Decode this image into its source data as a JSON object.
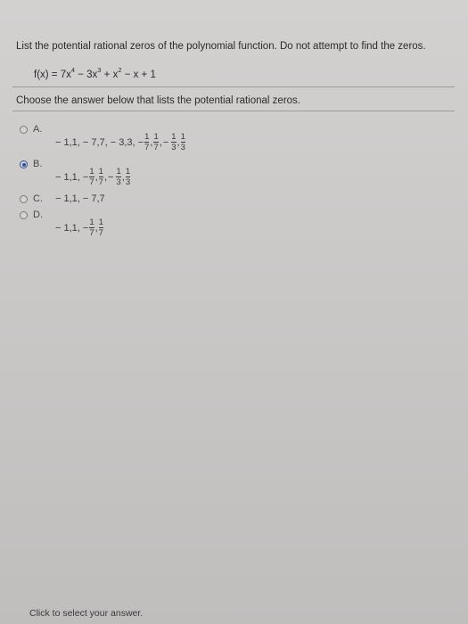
{
  "question": {
    "prompt": "List the potential rational zeros of the polynomial function. Do not attempt to find the zeros.",
    "formula": {
      "lhs": "f(x) = 7x",
      "exp1": "4",
      "t2": " − 3x",
      "exp2": "3",
      "t3": " + x",
      "exp3": "2",
      "t4": " − x + 1"
    },
    "instruction": "Choose the answer below that lists the potential rational zeros."
  },
  "options": [
    {
      "letter": "A.",
      "selected": false,
      "prefix": "− 1,1, − 7,7, − 3,3, −",
      "fracs": [
        {
          "num": "1",
          "den": "7"
        },
        {
          "num": "1",
          "den": "7"
        },
        {
          "num": "1",
          "den": "3"
        },
        {
          "num": "1",
          "den": "3"
        }
      ]
    },
    {
      "letter": "B.",
      "selected": true,
      "prefix": "− 1,1, −",
      "fracs": [
        {
          "num": "1",
          "den": "7"
        },
        {
          "num": "1",
          "den": "7"
        },
        {
          "num": "1",
          "den": "3"
        },
        {
          "num": "1",
          "den": "3"
        }
      ]
    },
    {
      "letter": "C.",
      "selected": false,
      "text": "− 1,1, − 7,7"
    },
    {
      "letter": "D.",
      "selected": false,
      "prefix": "− 1,1, −",
      "fracs": [
        {
          "num": "1",
          "den": "7"
        },
        {
          "num": "1",
          "den": "7"
        }
      ]
    }
  ],
  "footer": "Click to select your answer.",
  "colors": {
    "background": "#cac8c7",
    "radio_selected": "#2f4f9d"
  }
}
